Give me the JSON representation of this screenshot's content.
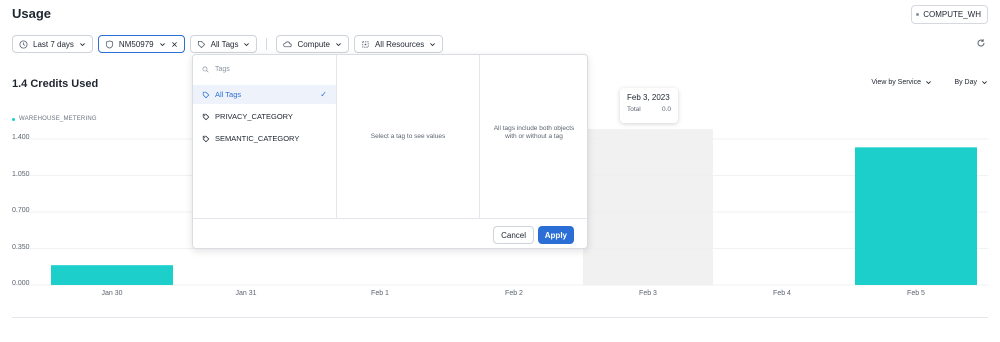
{
  "page": {
    "title": "Usage"
  },
  "warehouse_chip": {
    "label": "COMPUTE_WH",
    "icon": "warehouse-dot-icon"
  },
  "filters": {
    "date_range": {
      "label": "Last 7 days",
      "icon": "clock-icon"
    },
    "account": {
      "label": "NM50979",
      "icon": "shield-icon"
    },
    "tags": {
      "label": "All Tags",
      "icon": "tag-icon"
    },
    "service": {
      "label": "Compute",
      "icon": "cloud-icon"
    },
    "resources": {
      "label": "All Resources",
      "icon": "resources-icon"
    }
  },
  "summary": {
    "credits_used": "1.4 Credits Used"
  },
  "controls": {
    "view_by": "View by Service",
    "by_day": "By Day"
  },
  "tooltip": {
    "title": "Feb 3, 2023",
    "row_label": "Total",
    "row_value": "0.0"
  },
  "tag_dropdown": {
    "search_placeholder": "Tags",
    "items": [
      {
        "label": "All Tags",
        "selected": true
      },
      {
        "label": "PRIVACY_CATEGORY",
        "selected": false
      },
      {
        "label": "SEMANTIC_CATEGORY",
        "selected": false
      }
    ],
    "values_hint": "Select a tag to see values",
    "info_text": "All tags include both objects with or without a tag",
    "cancel_label": "Cancel",
    "apply_label": "Apply"
  },
  "colors": {
    "accent": "#2b6fd6",
    "series": "#1ccfcb",
    "highlight": "#f1f1f1"
  },
  "chart_data": {
    "type": "bar",
    "categories": [
      "Jan 30",
      "Jan 31",
      "Feb 1",
      "Feb 2",
      "Feb 3",
      "Feb 4",
      "Feb 5"
    ],
    "series": [
      {
        "name": "WAREHOUSE_METERING",
        "values": [
          0.19,
          0,
          0,
          0,
          0,
          0,
          1.32
        ]
      }
    ],
    "yticks": [
      "0.000",
      "0.350",
      "0.700",
      "1.050",
      "1.400"
    ],
    "ylim": [
      0,
      1.4
    ],
    "highlighted_category": "Feb 3",
    "legend": "top-left"
  }
}
